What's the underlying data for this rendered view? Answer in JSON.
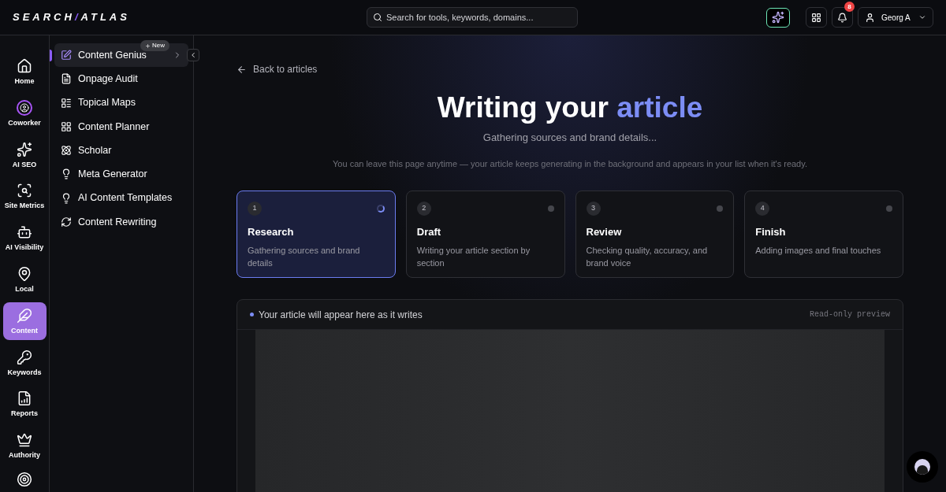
{
  "logo": {
    "left": "SEARCH",
    "slash": "/",
    "right": "ATLAS"
  },
  "search": {
    "placeholder": "Search for tools, keywords, domains..."
  },
  "notifications": {
    "count": "8"
  },
  "user": {
    "name": "Georg A"
  },
  "rail": [
    {
      "kind": "home",
      "label": "Home",
      "selected": false
    },
    {
      "kind": "coworker",
      "label": "Coworker",
      "selected": false
    },
    {
      "kind": "sparkles",
      "label": "AI SEO",
      "selected": false
    },
    {
      "kind": "metrics",
      "label": "Site Metrics",
      "selected": false
    },
    {
      "kind": "bot",
      "label": "AI Visibility",
      "selected": false
    },
    {
      "kind": "pin",
      "label": "Local",
      "selected": false
    },
    {
      "kind": "feather",
      "label": "Content",
      "selected": true
    },
    {
      "kind": "key",
      "label": "Keywords",
      "selected": false
    },
    {
      "kind": "report",
      "label": "Reports",
      "selected": false
    },
    {
      "kind": "crown",
      "label": "Authority",
      "selected": false
    },
    {
      "kind": "target"
    }
  ],
  "submenu": [
    {
      "kind": "edit",
      "label": "Content Genius",
      "selected": true,
      "badge": "New"
    },
    {
      "kind": "audit",
      "label": "Onpage Audit",
      "selected": false
    },
    {
      "kind": "maps",
      "label": "Topical Maps",
      "selected": false
    },
    {
      "kind": "planner",
      "label": "Content Planner",
      "selected": false
    },
    {
      "kind": "scholar",
      "label": "Scholar",
      "selected": false
    },
    {
      "kind": "bulb",
      "label": "Meta Generator",
      "selected": false
    },
    {
      "kind": "bulb",
      "label": "AI Content Templates",
      "selected": false
    },
    {
      "kind": "rewrite",
      "label": "Content Rewriting",
      "selected": false
    }
  ],
  "back_link": "Back to articles",
  "heading": {
    "text": "Writing your",
    "highlight": "article"
  },
  "subtitle": "Gathering sources and brand details...",
  "note": "You can leave this page anytime — your article keeps generating in the background and appears in your list when it's ready.",
  "steps": [
    {
      "number": "1",
      "title": "Research",
      "description": "Gathering sources and brand details",
      "selected": true
    },
    {
      "number": "2",
      "title": "Draft",
      "description": "Writing your article section by section",
      "selected": false
    },
    {
      "number": "3",
      "title": "Review",
      "description": "Checking quality, accuracy, and brand voice",
      "selected": false
    },
    {
      "number": "4",
      "title": "Finish",
      "description": "Adding images and final touches",
      "selected": false
    }
  ],
  "preview": {
    "title": "Your article will appear here as it writes",
    "mode": "Read-only preview"
  }
}
